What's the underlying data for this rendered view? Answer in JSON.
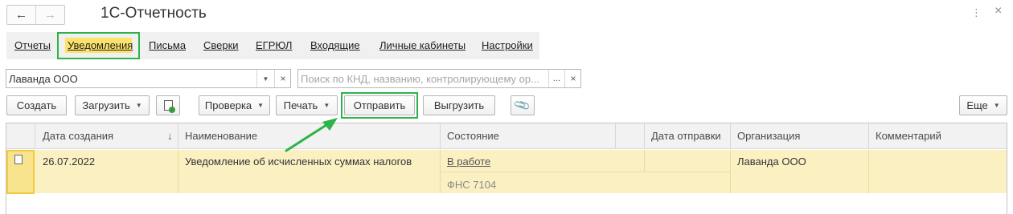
{
  "window": {
    "title": "1С-Отчетность",
    "back_icon": "←",
    "forward_icon": "→",
    "more_icon": "⋮",
    "close_icon": "×"
  },
  "tabs": [
    {
      "label": "Отчеты",
      "active": false
    },
    {
      "label": "Уведомления",
      "active": true
    },
    {
      "label": "Письма",
      "active": false
    },
    {
      "label": "Сверки",
      "active": false
    },
    {
      "label": "ЕГРЮЛ",
      "active": false
    },
    {
      "label": "Входящие",
      "active": false
    },
    {
      "label": "Личные кабинеты",
      "active": false
    },
    {
      "label": "Настройки",
      "active": false
    }
  ],
  "filters": {
    "organization_value": "Лаванда ООО",
    "search_placeholder": "Поиск по КНД, названию, контролирующему ор...",
    "dots_icon": "...",
    "clear_icon": "×",
    "dropdown_icon": "▼"
  },
  "toolbar": {
    "create_label": "Создать",
    "load_label": "Загрузить",
    "check_label": "Проверка",
    "print_label": "Печать",
    "send_label": "Отправить",
    "export_label": "Выгрузить",
    "more_label": "Еще",
    "caret": "▼"
  },
  "table": {
    "columns": [
      "Дата создания",
      "Наименование",
      "Состояние",
      "Дата отправки",
      "Организация",
      "Комментарий"
    ],
    "sort_indicator": "↓",
    "rows": [
      {
        "date_created": "26.07.2022",
        "name": "Уведомление об исчисленных суммах налогов",
        "status": "В работе",
        "status_sub": "ФНС 7104",
        "date_sent": "",
        "organization": "Лаванда ООО",
        "comment": ""
      }
    ]
  },
  "colors": {
    "highlight_frame": "#2db34a",
    "active_tab_background": "#fde36b",
    "selected_row": "#fbf0c2"
  }
}
